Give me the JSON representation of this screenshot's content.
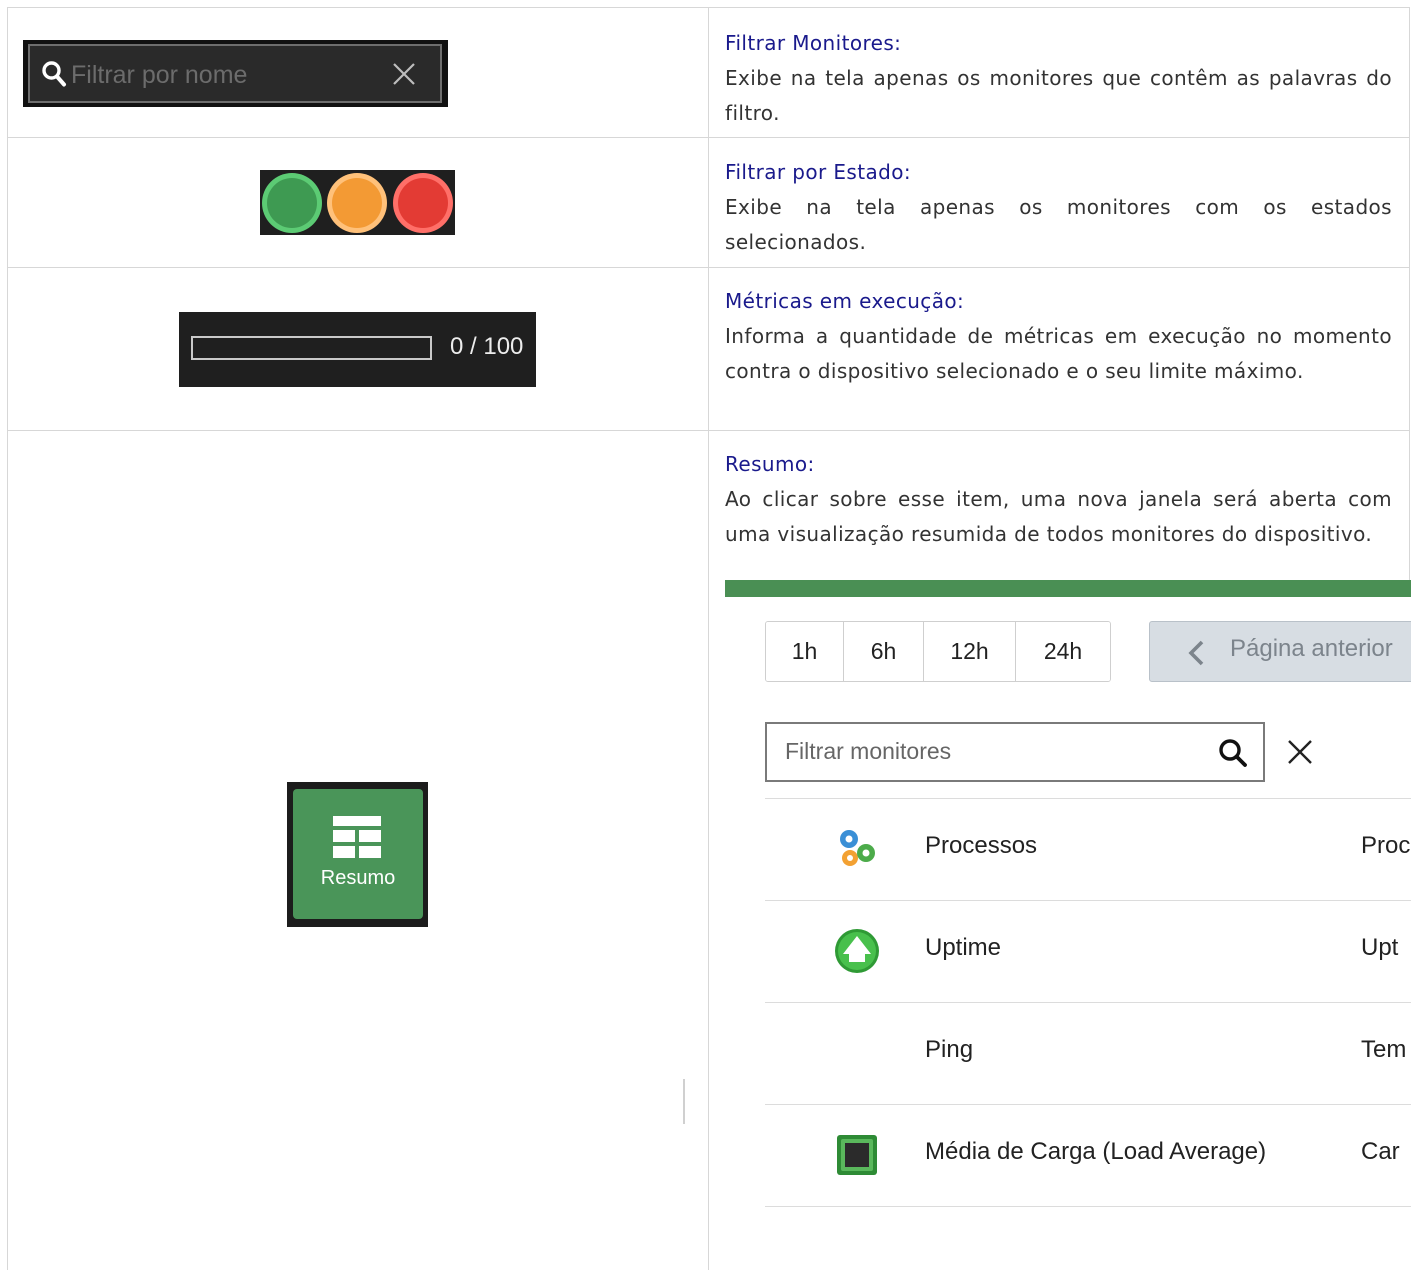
{
  "rows": [
    {
      "title": "Filtrar Monitores:",
      "description": "Exibe na tela apenas os monitores que contêm as palavras do filtro.",
      "search_placeholder": "Filtrar por nome"
    },
    {
      "title": "Filtrar por Estado:",
      "description": "Exibe na tela apenas os monitores com os estados selecionados.",
      "states": [
        {
          "name": "ok",
          "color": "#3e9a52",
          "ring": "#5ccb74"
        },
        {
          "name": "warning",
          "color": "#f39a34",
          "ring": "#ffc17a"
        },
        {
          "name": "critical",
          "color": "#e33b34",
          "ring": "#ff6f68"
        }
      ]
    },
    {
      "title": "Métricas em execução:",
      "description": "Informa a quantidade de métricas em execução no momento contra o dispositivo selecionado e o seu limite máximo.",
      "count_text": "0 / 100",
      "progress_fraction": 0
    },
    {
      "title": "Resumo:",
      "description": "Ao clicar sobre esse item, uma nova janela será aberta com uma visualização resumida de todos monitores do dispositivo.",
      "button_label": "Resumo"
    }
  ],
  "summary_window": {
    "accent_color": "#4a8f54",
    "time_ranges": [
      {
        "label": "1h",
        "active": false
      },
      {
        "label": "6h",
        "active": false
      },
      {
        "label": "12h",
        "active": false
      },
      {
        "label": "24h",
        "active": true
      }
    ],
    "prev_page_label": "Página anterior",
    "filter_placeholder": "Filtrar monitores",
    "monitors": [
      {
        "name": "Processos",
        "type": "Proc",
        "icon": "gears-icon"
      },
      {
        "name": "Uptime",
        "type": "Upt",
        "icon": "uptime-arrow-icon"
      },
      {
        "name": "Ping",
        "type": "Tem",
        "icon": ""
      },
      {
        "name": "Média de Carga (Load Average)",
        "type": "Car",
        "icon": "chip-icon"
      }
    ]
  }
}
